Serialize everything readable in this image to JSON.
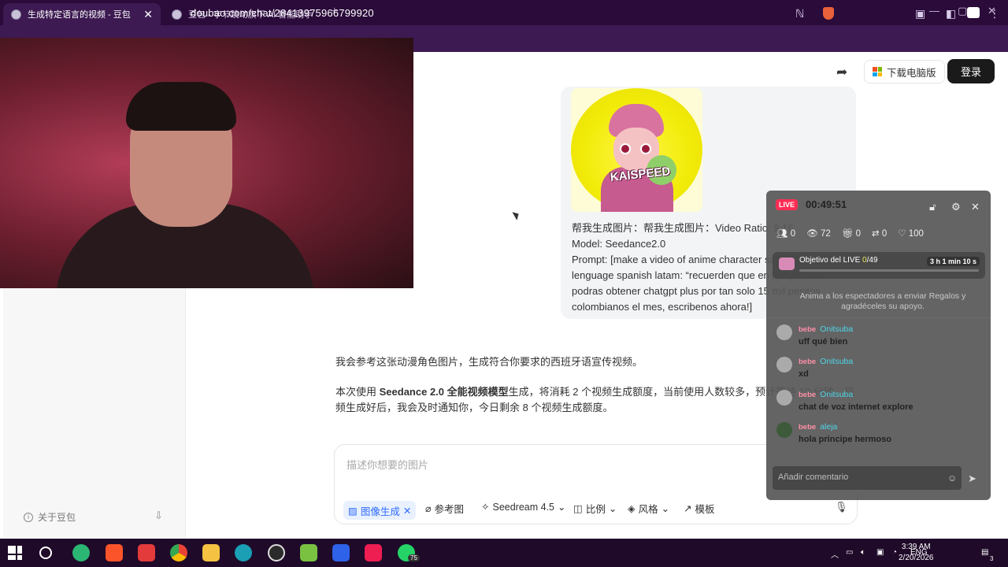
{
  "browser": {
    "tabs": [
      {
        "title": "生成特定语言的视频 - 豆包",
        "active": true
      },
      {
        "title": "豆包 - 字节跳动旗下 AI 智能助手",
        "active": false
      }
    ],
    "url": "doubao.com/chat/28413975966799920"
  },
  "page": {
    "share_icon": "share-icon",
    "download_label": "下载电脑版",
    "login_label": "登录",
    "about_label": "关于豆包",
    "image_badge_text": "KAISPEED",
    "request_lines": [
      "帮我生成图片：帮我生成图片：Video Ratio: 9:16",
      "Model: Seedance2.0",
      "Prompt: [make a video of anime character saying in lenguage spanish latam: “recuerden que en la npc store podras obtener chatgpt plus por tan solo 15 mil pesitos colombianos el mes, escribenos ahora!]"
    ],
    "answer_p1": "我会参考这张动漫角色图片，生成符合你要求的西班牙语宣传视频。",
    "answer_p2_before": "本次使用 ",
    "answer_p2_bold": "Seedance 2.0 全能视频模型",
    "answer_p2_after": "生成，将消耗 2 个视频生成额度，当前使用人数较多，预计等待 10 分钟，视频生成好后，我会及时通知你，今日剩余 8 个视频生成额度。",
    "input_placeholder": "描述你想要的图片",
    "tools": {
      "image_gen": "图像生成",
      "reference": "参考图",
      "model": "Seedream 4.5",
      "ratio": "比例",
      "style": "风格",
      "template": "模板"
    }
  },
  "live": {
    "badge": "LIVE",
    "timer": "00:49:51",
    "stats": {
      "guests": "0",
      "views": "72",
      "gifts": "0",
      "shares": "0",
      "likes": "100"
    },
    "goal_label": "Objetivo del LIVE",
    "goal_current": "0",
    "goal_total": "/49",
    "goal_progress": 0,
    "goal_time": "3 h 1 min 10 s",
    "hint": "Anima a los espectadores a enviar Regalos y agradéceles su apoyo.",
    "comments": [
      {
        "badge": "bebe",
        "name": "Onitsuba",
        "text": "uff qué bien"
      },
      {
        "badge": "bebe",
        "name": "Onitsuba",
        "text": "xd"
      },
      {
        "badge": "bebe",
        "name": "Onitsuba",
        "text": "chat de voz internet explore"
      },
      {
        "badge": "bebe",
        "name": "aleja",
        "text": "hola principe hermoso"
      }
    ],
    "comment_placeholder": "Añadir comentario"
  },
  "taskbar": {
    "lang": "ENG",
    "time": "3:39 AM",
    "date": "2/20/2026",
    "whatsapp_badge": "75",
    "notification_count": "3"
  },
  "colors": {
    "chrome_bg": "#2a0b3a",
    "login_bg": "#1a1a1a",
    "live_red": "#ff2d55",
    "accent_blue": "#2f6bff"
  }
}
